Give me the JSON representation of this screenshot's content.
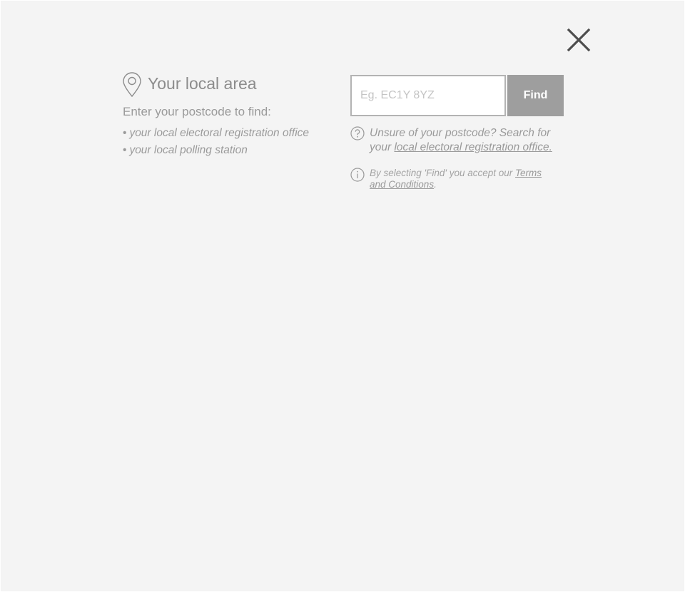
{
  "dialog": {
    "heading": "Your local area",
    "intro": "Enter your postcode to find:",
    "bullets": [
      "your local electoral registration office",
      "your local polling station"
    ],
    "bullet_char": "•"
  },
  "search": {
    "value": "",
    "placeholder": "Eg. EC1Y 8YZ",
    "find_label": "Find"
  },
  "help": {
    "text_before": "Unsure of your postcode? Search for your ",
    "link_text": "local electoral registration office."
  },
  "terms": {
    "text_before": "By selecting 'Find' you accept our ",
    "link_text": "Terms and Conditions",
    "text_after": "."
  },
  "icons": {
    "close": "close-icon",
    "location": "location-pin-icon",
    "help": "question-circle-icon",
    "info": "info-circle-icon"
  },
  "colors": {
    "panel_background": "#f4f4f4",
    "find_button": "#9e9e9e",
    "muted_text": "#9a9a9a",
    "close_icon": "#4d4d4d"
  }
}
